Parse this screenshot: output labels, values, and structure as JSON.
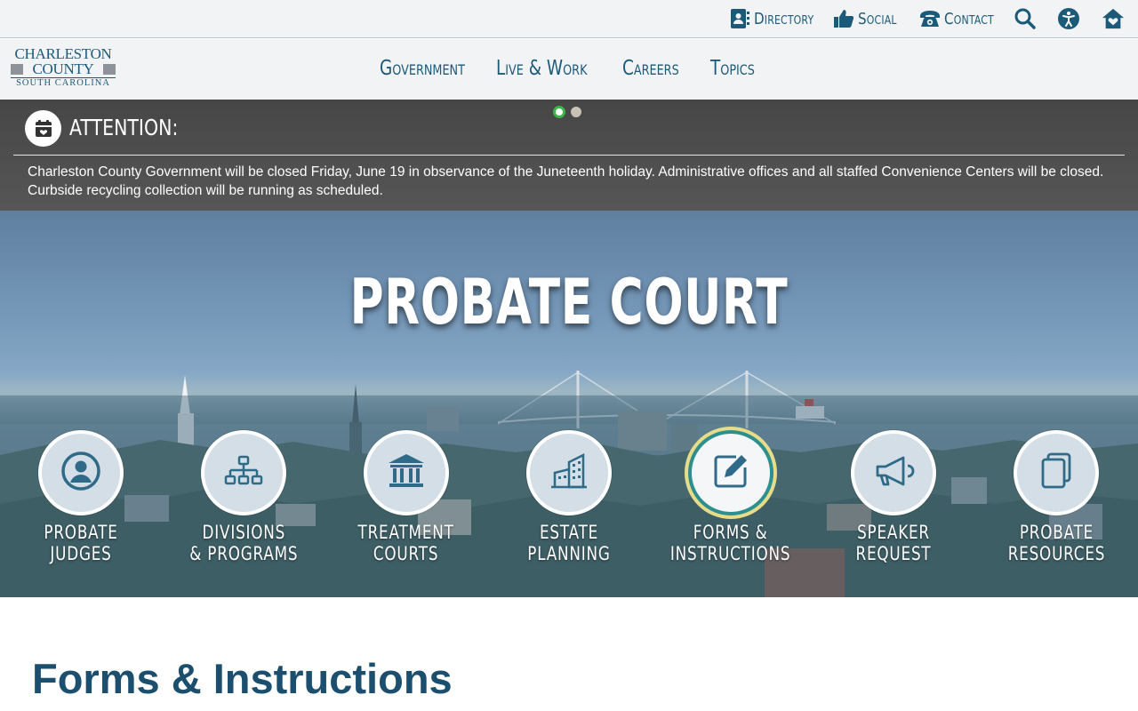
{
  "utility_nav": [
    {
      "label": "Directory",
      "icon": "contact-book-icon"
    },
    {
      "label": "Social",
      "icon": "thumbs-up-icon"
    },
    {
      "label": "Contact",
      "icon": "phone-icon"
    },
    {
      "label": "",
      "icon": "search-icon"
    },
    {
      "label": "",
      "icon": "accessibility-icon"
    },
    {
      "label": "",
      "icon": "home-icon"
    }
  ],
  "logo": {
    "line1": "CHARLESTON",
    "line2": "COUNTY",
    "line3": "SOUTH CAROLINA"
  },
  "main_nav": [
    "Government",
    "Live & Work",
    "Careers",
    "Topics"
  ],
  "alert": {
    "title": "ATTENTION:",
    "icon": "calendar-icon",
    "message": "Charleston County Government will be closed Friday, June 19 in observance of the Juneteenth holiday. Administrative offices and all staffed Convenience Centers will be closed. Curbside recycling collection will be running as scheduled.",
    "slides": 2,
    "active_slide": 1
  },
  "hero": {
    "title": "PROBATE COURT",
    "quick_links": [
      {
        "label": "PROBATE JUDGES",
        "icon": "person-icon",
        "active": false
      },
      {
        "label": "DIVISIONS\n& PROGRAMS",
        "icon": "org-chart-icon",
        "active": false
      },
      {
        "label": "TREATMENT\nCOURTS",
        "icon": "courthouse-icon",
        "active": false
      },
      {
        "label": "ESTATE PLANNING",
        "icon": "buildings-icon",
        "active": false
      },
      {
        "label": "FORMS &\nINSTRUCTIONS",
        "icon": "edit-form-icon",
        "active": true
      },
      {
        "label": "SPEAKER REQUEST",
        "icon": "megaphone-icon",
        "active": false
      },
      {
        "label": "PROBATE\nRESOURCES",
        "icon": "documents-icon",
        "active": false
      }
    ]
  },
  "page": {
    "title": "Forms & Instructions"
  },
  "colors": {
    "brand_blue": "#1c5a79",
    "alert_bg": "#4f4f4f",
    "active_dot": "#39b54a",
    "active_ring": "#e7dc8a"
  }
}
